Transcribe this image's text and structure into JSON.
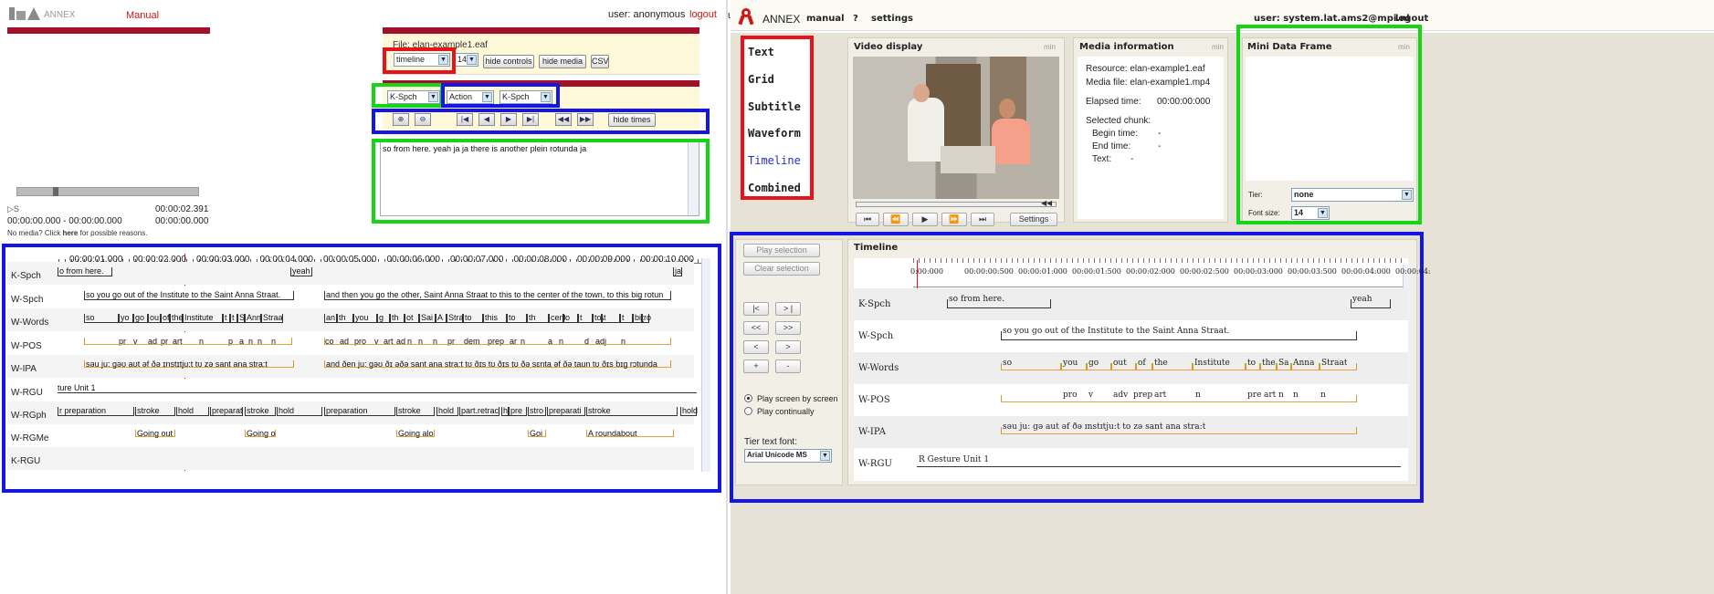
{
  "left": {
    "brand": "ANNEX",
    "manual": "Manual",
    "user": "user: anonymous",
    "logout": "logout",
    "file_label": "File: elan-example1.eaf",
    "view_select": "timeline",
    "size_select": "14",
    "hide_controls": "hide controls",
    "hide_media": "hide media",
    "csv": "CSV",
    "tier_select1": "K-Spch",
    "tier_select2": "Action",
    "tier_select3": "K-Spch",
    "hide_times": "hide times",
    "text_content": "so from here.  yeah  ja  ja  there is another plein  rotunda  ja",
    "media_status": "▷S",
    "media_time": "00:00:02.391",
    "selection_range": "00:00:00.000 - 00:00:00.000",
    "selection_dur": "00:00:00.000",
    "no_media_pre": "No media? Click ",
    "no_media_link": "here",
    "no_media_post": " for possible reasons.",
    "ruler": [
      "00:00:01.000",
      "00:00:02.000",
      "00:00:03.000",
      "00:00:04.000",
      "00:00:05.000",
      "00:00:06.000",
      "00:00:07.000",
      "00:00:08.000",
      "00:00:09.000",
      "00:00:10.000"
    ],
    "tiers": [
      "K-Spch",
      "W-Spch",
      "W-Words",
      "W-POS",
      "W-IPA",
      "W-RGU",
      "W-RGph",
      "W-RGMe",
      "K-RGU"
    ],
    "kspch": [
      "o from here.",
      "yeah",
      "ja"
    ],
    "wspch": [
      "so you go out of the Institute to the Saint Anna Straat.",
      "and then you go the other, Saint Anna Straat to this to the center of the town, to this big rotun"
    ],
    "words": [
      "so",
      "yo",
      "go",
      "ou",
      "of",
      "the",
      "Institute",
      "t",
      "t",
      "S",
      "Ann",
      "Straa",
      "an",
      "th",
      "you",
      "g",
      "th",
      "ot",
      "Sai",
      "A",
      "Stra",
      "to",
      "this",
      "to",
      "th",
      "cent",
      "o",
      "t",
      "town",
      "t",
      "t",
      "big",
      "rotunde"
    ],
    "pos": [
      "pr",
      "v",
      "ad",
      "pr",
      "art",
      "n",
      "p",
      "a",
      "n",
      "n",
      "n",
      "co",
      "ad",
      "pro",
      "v",
      "art",
      "ad",
      "n",
      "n",
      "n",
      "pr",
      "dem",
      "prep",
      "ar",
      "n",
      "a",
      "n",
      "d",
      "adj",
      "n"
    ],
    "ipa": [
      "səu  ju: gəʊ aʊt əf ðə ɪnstɪtju:t tʊ zə sant ana stra:t",
      "and ðen ju: gəʊ ðɪ əðə sant ana stra:t tʊ ðɪs tʊ ðɪs tʊ ðə sɛnta əf ðə taun tʊ ðɪs bɪg rɔtunda"
    ],
    "rgu": "ture Unit 1",
    "rgph": [
      "r preparation",
      "stroke",
      "hold",
      "preparat",
      "stroke",
      "hold",
      "preparation",
      "stroke",
      "hold",
      "part.retrac",
      "h",
      "pre",
      "stro",
      "preparati",
      "stroke",
      "hold"
    ],
    "rgme": [
      "Going out",
      "Going o",
      "Going alo",
      "Goi",
      "A roundabout"
    ]
  },
  "right": {
    "brand": "ANNEX",
    "manual": "manual",
    "help": "?",
    "settings": "settings",
    "user": "user: system.lat.ams2@mpi.nl",
    "logout": "logout",
    "views": [
      "Text",
      "Grid",
      "Subtitle",
      "Waveform",
      "Timeline",
      "Combined"
    ],
    "video_title": "Video display",
    "media_title": "Media information",
    "mini_title": "Mini Data Frame",
    "min": "min",
    "video_settings": "Settings",
    "resource": "Resource:  elan-example1.eaf",
    "media_file": "Media file:  elan-example1.mp4",
    "elapsed_label": "Elapsed time:",
    "elapsed_value": "00:00:00:000",
    "selected_chunk": "Selected chunk:",
    "begin_label": "Begin time:",
    "begin_value": "-",
    "end_label": "End time:",
    "end_value": "-",
    "text_label": "Text:",
    "text_value": "-",
    "tier_label": "Tier:",
    "tier_value": "none",
    "font_label": "Font size:",
    "font_value": "14",
    "play_selection": "Play selection",
    "clear_selection": "Clear selection",
    "nav_buttons": [
      "|<",
      "> |",
      "<<",
      ">>",
      "<",
      ">",
      "+",
      "-"
    ],
    "play_screen": "Play screen by screen",
    "play_cont": "Play continually",
    "tier_font_label": "Tier text font:",
    "tier_font_value": "Arial Unicode MS",
    "timeline_title": "Timeline",
    "ruler": [
      "0:00:000",
      "00:00:00:500",
      "00:00:01:000",
      "00:00:01:500",
      "00:00:02:000",
      "00:00:02:500",
      "00:00:03:000",
      "00:00:03:500",
      "00:00:04:000",
      "00:00:04:"
    ],
    "tiers": [
      "K-Spch",
      "W-Spch",
      "W-Words",
      "W-POS",
      "W-IPA",
      "W-RGU"
    ],
    "kspch": [
      "so from here.",
      "yeah"
    ],
    "wspch": "so you go out of the Institute to the Saint Anna Straat.",
    "words": [
      "so",
      "you",
      "go",
      "out",
      "of",
      "the",
      "Institute",
      "to",
      "the",
      "Sa",
      "Anna",
      "Straat"
    ],
    "pos": [
      "pro",
      "v",
      "adv",
      "prep",
      "art",
      "n",
      "pre",
      "art",
      "n",
      "n",
      "n"
    ],
    "ipa": "səu  ju: gə aut əf ðə ɪnstɪtju:t to zə sant ana stra:t",
    "rgu": "R Gesture Unit 1"
  }
}
